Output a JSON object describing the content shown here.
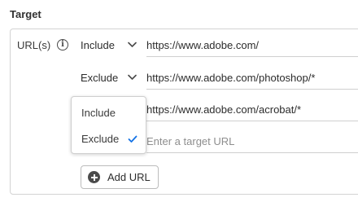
{
  "section": {
    "title": "Target"
  },
  "urls": {
    "label": "URL(s)",
    "rows": [
      {
        "mode": "Include",
        "url": "https://www.adobe.com/"
      },
      {
        "mode": "Exclude",
        "url": "https://www.adobe.com/photoshop/*"
      },
      {
        "mode": "Exclude",
        "url": "https://www.adobe.com/acrobat/*"
      }
    ],
    "new_url_placeholder": "Enter a target URL"
  },
  "dropdown": {
    "options": [
      "Include",
      "Exclude"
    ],
    "selected": "Exclude"
  },
  "actions": {
    "add_url_label": "Add URL"
  },
  "colors": {
    "accent": "#1473e6",
    "border": "#d3d3d3"
  }
}
